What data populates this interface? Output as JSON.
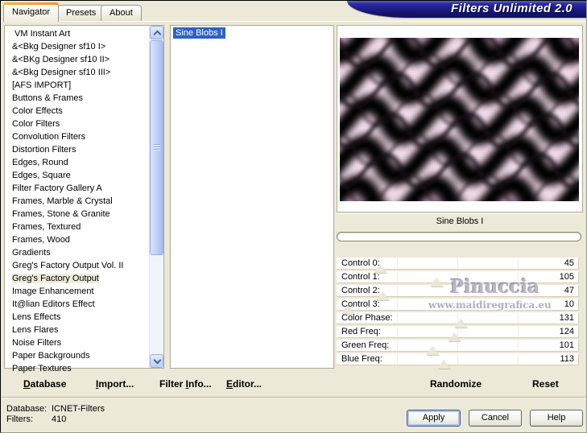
{
  "window": {
    "banner_title": "Filters Unlimited 2.0"
  },
  "tabs": [
    {
      "label": "Navigator",
      "active": true
    },
    {
      "label": "Presets",
      "active": false
    },
    {
      "label": "About",
      "active": false
    }
  ],
  "category_list": {
    "items": [
      " VM Instant Art",
      "&<Bkg Designer sf10 I>",
      "&<BKg Designer sf10 II>",
      "&<Bkg Designer sf10 III>",
      "[AFS IMPORT]",
      "Buttons & Frames",
      "Color Effects",
      "Color Filters",
      "Convolution Filters",
      "Distortion Filters",
      "Edges, Round",
      "Edges, Square",
      "Filter Factory Gallery A",
      "Frames, Marble & Crystal",
      "Frames, Stone & Granite",
      "Frames, Textured",
      "Frames, Wood",
      "Gradients",
      "Greg's Factory Output Vol. II",
      "Greg's Factory Output",
      "Image Enhancement",
      "It@lian Editors Effect",
      "Lens Effects",
      "Lens Flares",
      "Noise Filters",
      "Paper Backgrounds",
      "Paper Textures"
    ],
    "highlighted": "Greg's Factory Output"
  },
  "filter_list": {
    "items": [
      "Sine Blobs I"
    ],
    "selected": "Sine Blobs I"
  },
  "preview": {
    "filter_name": "Sine Blobs I",
    "progress_percent": 0
  },
  "controls_max": 255,
  "controls": [
    {
      "label": "Control 0:",
      "value": 45
    },
    {
      "label": "Control 1:",
      "value": 105
    },
    {
      "label": "Control 2:",
      "value": 47
    },
    {
      "label": "Control 3:",
      "value": 10
    },
    {
      "label": "Color Phase:",
      "value": 131
    },
    {
      "label": "Red Freq:",
      "value": 124
    },
    {
      "label": "Green Freq:",
      "value": 101
    },
    {
      "label": "Blue Freq:",
      "value": 113
    }
  ],
  "watermark": {
    "name": "Pinuccia",
    "site": "www.maidiregrafica.eu"
  },
  "toolbar": {
    "database": [
      "",
      "D",
      "atabase"
    ],
    "import_btn": [
      "",
      "I",
      "mport..."
    ],
    "filter_info": [
      "Filter ",
      "I",
      "nfo..."
    ],
    "editor": [
      "",
      "E",
      "ditor..."
    ],
    "randomize": "Randomize",
    "reset": "Reset"
  },
  "status": {
    "rows": [
      {
        "label": "Database:",
        "value": "ICNET-Filters"
      },
      {
        "label": "Filters:",
        "value": "410"
      }
    ]
  },
  "action_buttons": {
    "apply": "Apply",
    "cancel": "Cancel",
    "help": "Help"
  },
  "colors": {
    "dialog_beige": "#ece9d8",
    "selection_blue": "#2e62c4",
    "inactive_highlight": "#efecdb",
    "banner_navy": "#1a1a80",
    "tab_accent_orange": "#e8962e",
    "preview_pink_light": "#f6e0ee",
    "preview_dark": "#000000"
  }
}
